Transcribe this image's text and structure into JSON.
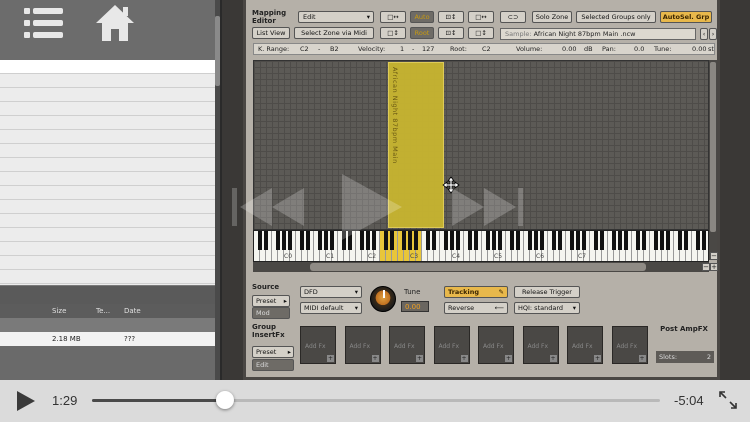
{
  "left_pane": {
    "file_columns": [
      "Size",
      "Te...",
      "Date"
    ],
    "file_row": {
      "size": "2.18 MB",
      "date": "???"
    }
  },
  "mapping_editor": {
    "label_line1": "Mapping",
    "label_line2": "Editor",
    "edit_dropdown": "Edit",
    "list_view": "List View",
    "select_zone_midi": "Select Zone via Midi",
    "auto_btn": "Auto",
    "root_btn": "Root",
    "solo_zone": "Solo Zone",
    "selected_groups_only": "Selected Groups only",
    "autosel_grp": "AutoSel. Grp",
    "sample_label": "Sample:",
    "sample_name": "African Night 87bpm Main .ncw",
    "status": {
      "k_range_label": "K. Range:",
      "k_range_low": "C2",
      "k_range_dash": "-",
      "k_range_high": "B2",
      "velocity_label": "Velocity:",
      "velocity_low": "1",
      "velocity_dash": "-",
      "velocity_high": "127",
      "root_label": "Root:",
      "root_value": "C2",
      "volume_label": "Volume:",
      "volume_value": "0.00",
      "volume_unit": "dB",
      "pan_label": "Pan:",
      "pan_value": "0.0",
      "tune_label": "Tune:",
      "tune_value": "0.00",
      "tune_unit": "st"
    },
    "zone_text": "African Night 87bpm Main",
    "key_labels": [
      "C0",
      "C1",
      "C2",
      "C3",
      "C4",
      "C5",
      "C6",
      "C7"
    ]
  },
  "source": {
    "label": "Source",
    "preset": "Preset",
    "mod": "Mod",
    "dfd": "DFD",
    "midi_default": "MIDI default",
    "tune_label": "Tune",
    "tune_value": "0.00",
    "tracking": "Tracking",
    "reverse": "Reverse",
    "release_trigger": "Release Trigger",
    "hq_standard": "HQI: standard"
  },
  "group_insert_fx": {
    "label_line1": "Group",
    "label_line2": "InsertFx",
    "preset": "Preset",
    "edit": "Edit",
    "slot_label": "Add Fx",
    "slot_count_display": 8,
    "post_amp_fx": "Post AmpFX",
    "slots_label": "Slots:",
    "slots_value": "2"
  },
  "video": {
    "elapsed": "1:29",
    "remaining": "-5:04",
    "progress": 0.2342
  }
}
